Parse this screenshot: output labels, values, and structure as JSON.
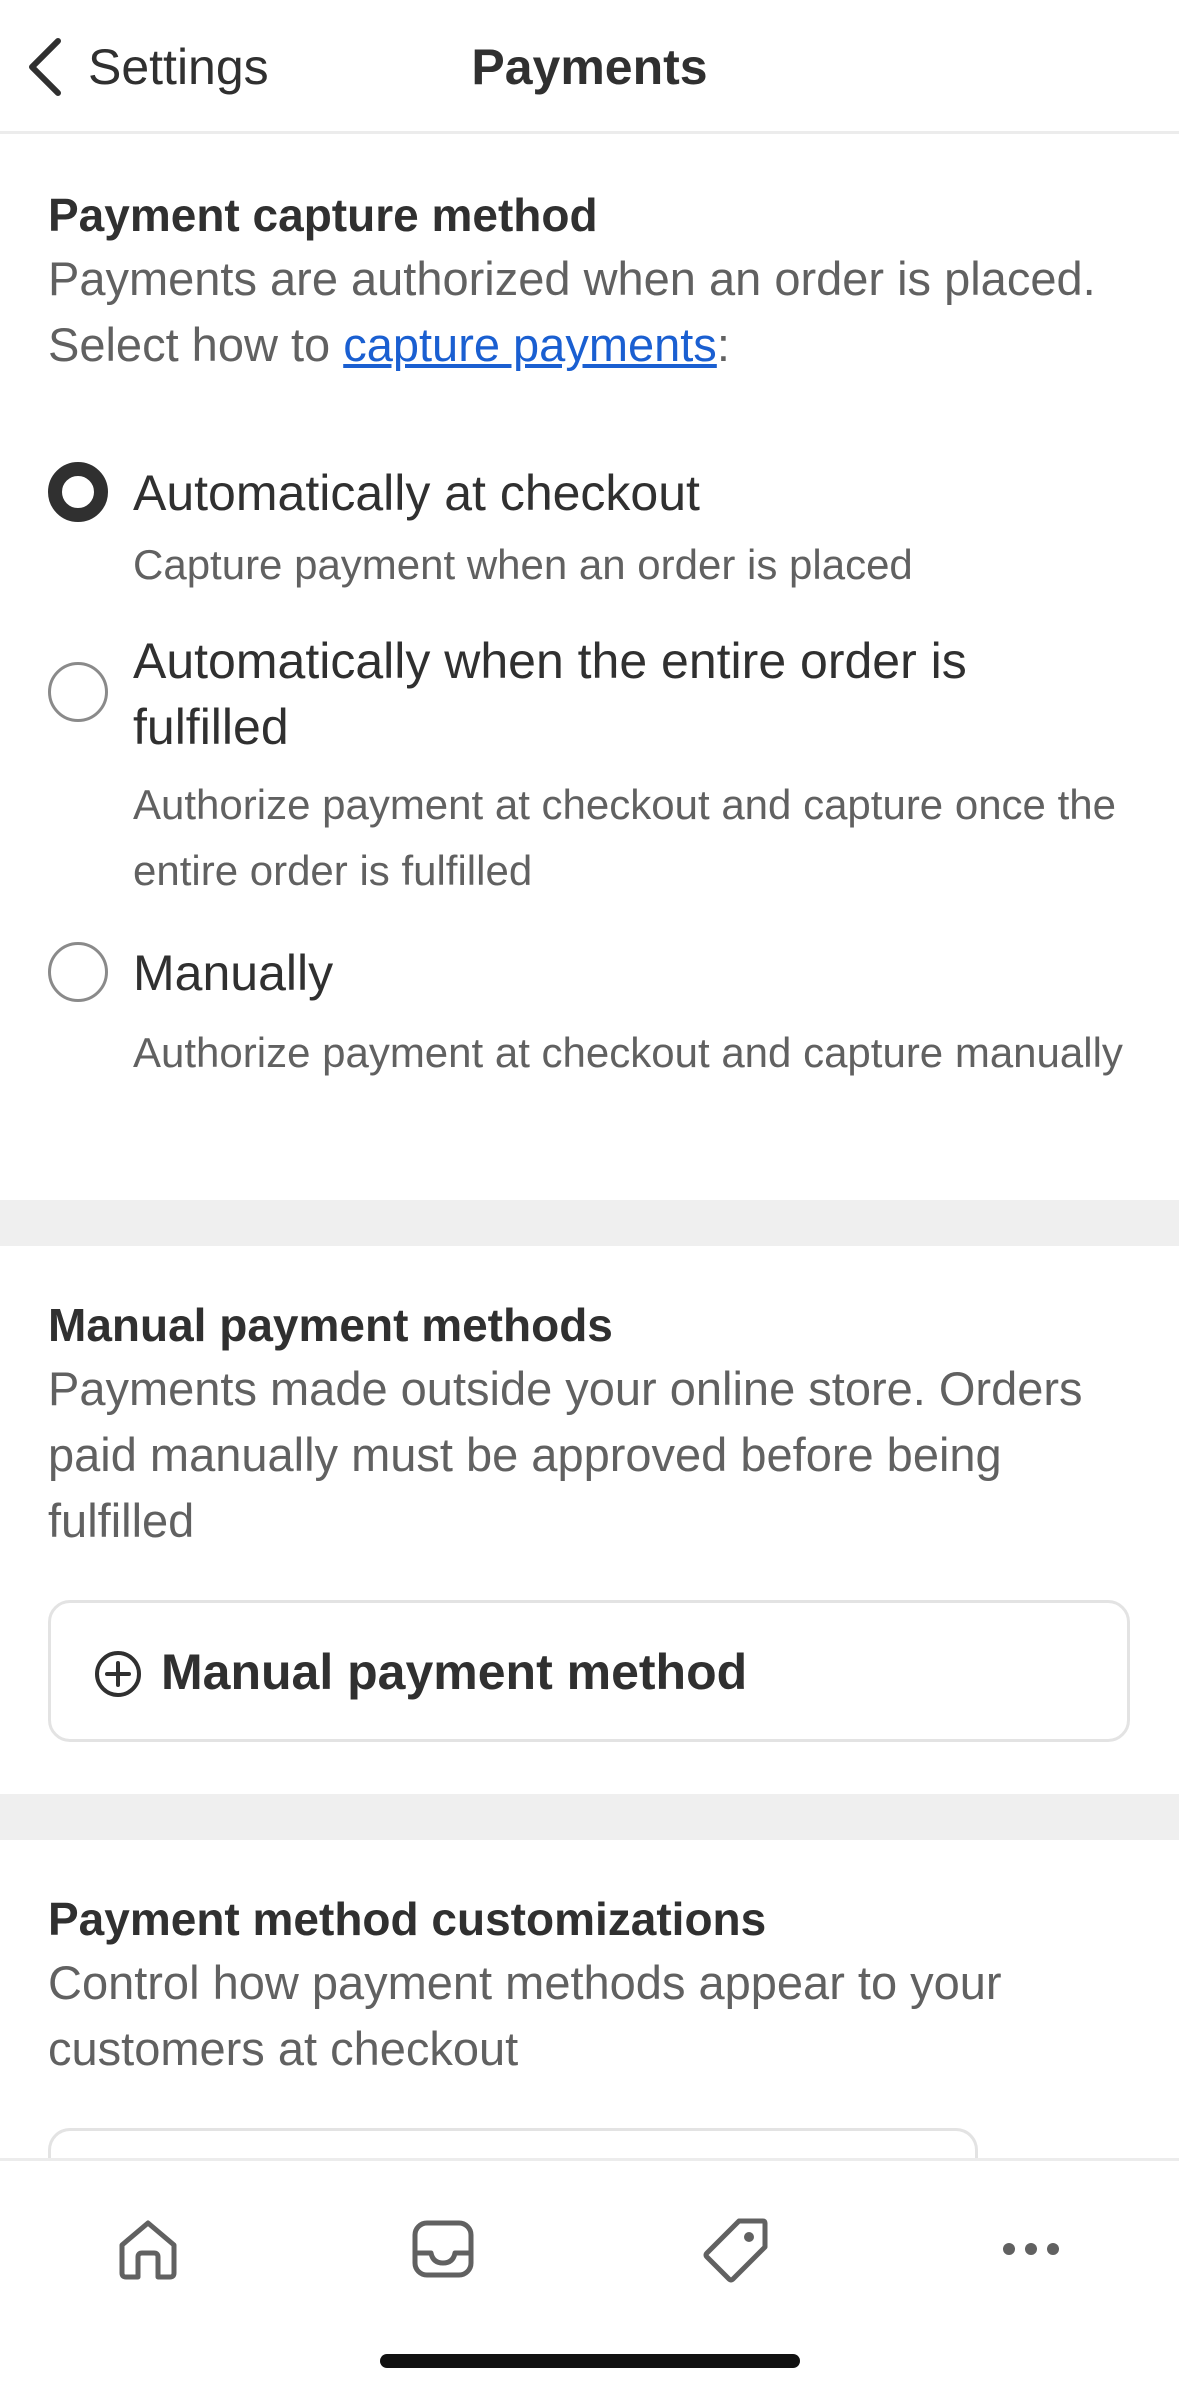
{
  "header": {
    "back_label": "Settings",
    "title": "Payments"
  },
  "capture": {
    "title": "Payment capture method",
    "desc_prefix": "Payments are authorized when an order is placed. Select how to ",
    "desc_link": "capture payments",
    "desc_suffix": ":",
    "options": [
      {
        "label": "Automatically at checkout",
        "help": "Capture payment when an order is placed",
        "selected": true
      },
      {
        "label": "Automatically when the entire order is fulfilled",
        "help": "Authorize payment at checkout and capture once the entire order is fulfilled",
        "selected": false
      },
      {
        "label": "Manually",
        "help": "Authorize payment at checkout and capture manually",
        "selected": false
      }
    ]
  },
  "manual": {
    "title": "Manual payment methods",
    "desc": "Payments made outside your online store. Orders paid manually must be approved before being fulfilled",
    "button_label": "Manual payment method"
  },
  "customizations": {
    "title": "Payment method customizations",
    "desc": "Control how payment methods appear to your customers at checkout"
  },
  "bottom_nav": {
    "icons": [
      "home-icon",
      "inbox-icon",
      "tag-icon",
      "more-icon"
    ]
  },
  "colors": {
    "link": "#1a5fd1",
    "text": "#303030",
    "muted": "#616161",
    "divider": "#efefef"
  }
}
